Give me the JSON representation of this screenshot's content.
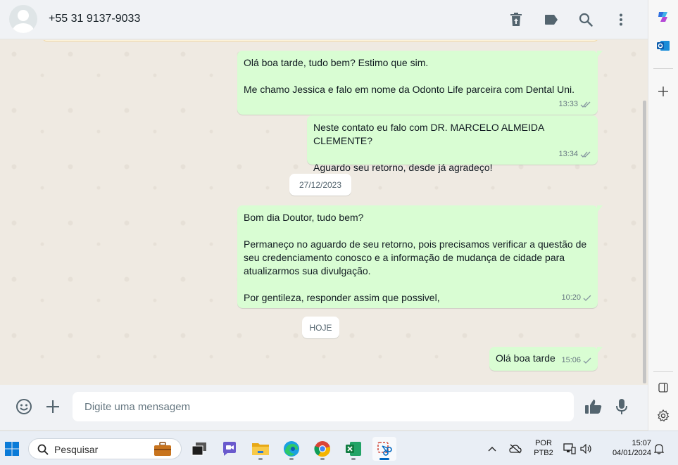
{
  "header": {
    "contact": "+55 31 9137-9033",
    "icons": [
      "delete-icon",
      "label-icon",
      "search-icon",
      "menu-icon"
    ]
  },
  "messages": [
    {
      "text": "Olá boa tarde, tudo bem? Estimo que sim.\n\nMe chamo Jessica e falo em nome da Odonto Life parceira com Dental Uni.",
      "time": "13:33",
      "status": "read"
    },
    {
      "text": "Neste contato eu falo com DR. MARCELO ALMEIDA CLEMENTE?\n\nAguardo seu retorno, desde já agradeço!",
      "time": "13:34",
      "status": "read"
    },
    {
      "text": "Bom dia Doutor, tudo bem?\n\nPermaneço no aguardo de seu retorno, pois precisamos verificar a questão de seu credenciamento conosco e a informação de mudança de cidade para atualizarmos sua divulgação.\n\nPor gentileza, responder assim que possivel,",
      "time": "10:20",
      "status": "sent"
    },
    {
      "text": "Olá boa tarde",
      "time": "15:06",
      "status": "sent"
    }
  ],
  "dates": {
    "first": "27/12/2023",
    "second": "HOJE"
  },
  "composer": {
    "placeholder": "Digite uma mensagem"
  },
  "taskbar": {
    "search_label": "Pesquisar",
    "lang_top": "POR",
    "lang_bottom": "PTB2",
    "time": "15:07",
    "date": "04/01/2024"
  },
  "colors": {
    "bubble": "#d9fdd3",
    "chat_bg": "#efeae2",
    "accent": "#0067c0"
  }
}
